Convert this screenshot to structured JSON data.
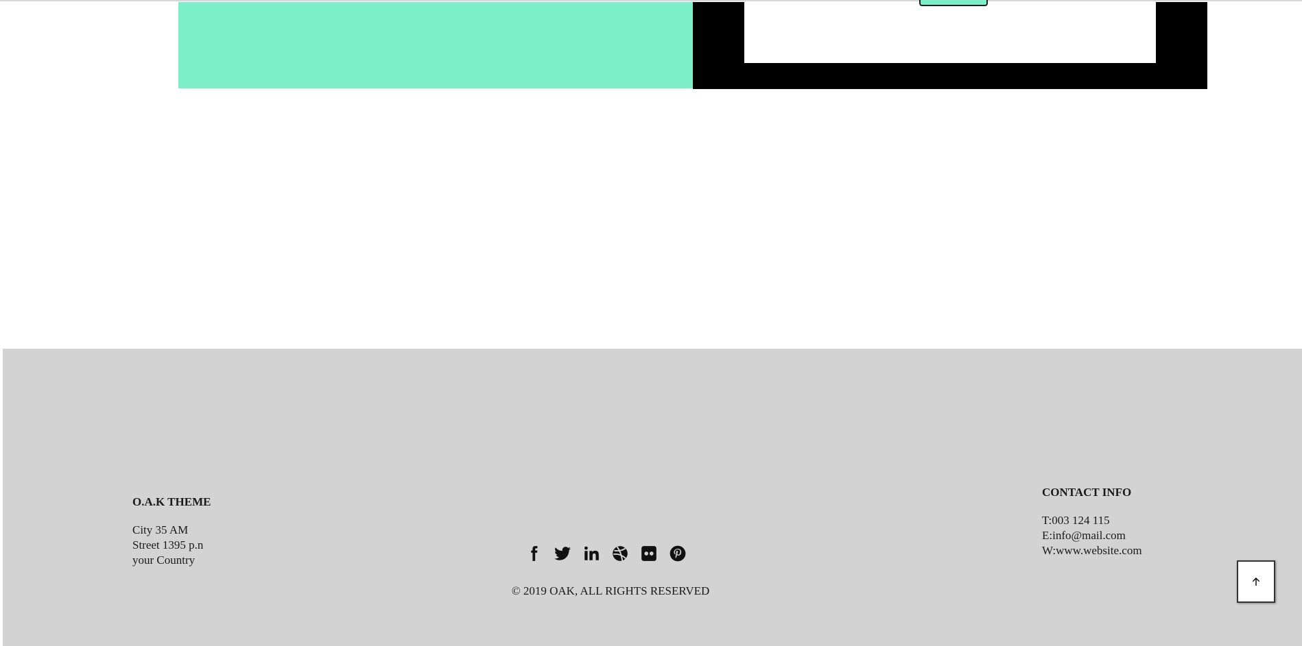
{
  "footer": {
    "brand": "O.A.K THEME",
    "address": [
      "City 35 AM",
      "Street 1395 p.n",
      "your Country"
    ],
    "contact": {
      "title": "CONTACT INFO",
      "lines": [
        "T:003 124 115",
        "E:info@mail.com",
        "W:www.website.com"
      ]
    },
    "social_icons": [
      "facebook-icon",
      "twitter-icon",
      "linkedin-icon",
      "dribbble-icon",
      "flickr-icon",
      "pinterest-icon"
    ],
    "copyright": "© 2019 OAK, ALL RIGHTS RESERVED"
  },
  "colors": {
    "mint": "#7cefc8",
    "footer_bg": "#d3d3d3",
    "black": "#000000"
  }
}
